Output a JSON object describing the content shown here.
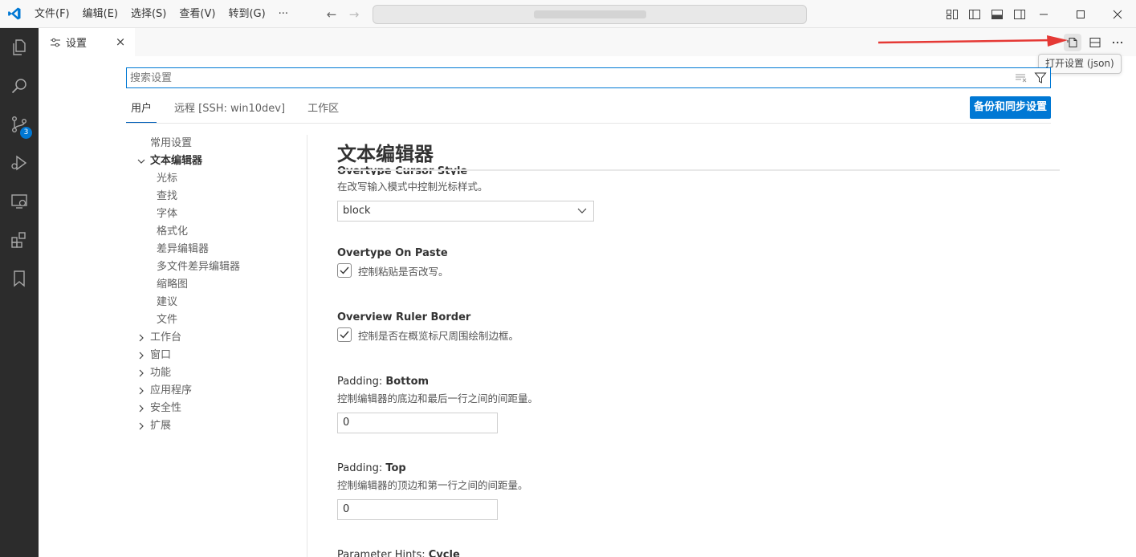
{
  "titlebar": {
    "menus": [
      "文件(F)",
      "编辑(E)",
      "选择(S)",
      "查看(V)",
      "转到(G)",
      "···"
    ]
  },
  "activity": {
    "scm_badge": "3"
  },
  "tab": {
    "label": "设置",
    "close": "×"
  },
  "tooltip": "打开设置 (json)",
  "search": {
    "placeholder": "搜索设置"
  },
  "scopes": {
    "user": "用户",
    "remote": "远程 [SSH: win10dev]",
    "workspace": "工作区"
  },
  "sync_button": "备份和同步设置",
  "toc": {
    "common": "常用设置",
    "text_editor": "文本编辑器",
    "children": [
      "光标",
      "查找",
      "字体",
      "格式化",
      "差异编辑器",
      "多文件差异编辑器",
      "缩略图",
      "建议",
      "文件"
    ],
    "collapsed": [
      "工作台",
      "窗口",
      "功能",
      "应用程序",
      "安全性",
      "扩展"
    ]
  },
  "content": {
    "section_title": "文本编辑器",
    "overtype_cursor_style": {
      "title": "Overtype Cursor Style",
      "desc": "在改写输入模式中控制光标样式。",
      "value": "block"
    },
    "overtype_on_paste": {
      "title": "Overtype On Paste",
      "desc": "控制粘贴是否改写。"
    },
    "overview_ruler_border": {
      "title": "Overview Ruler Border",
      "desc": "控制是否在概览标尺周围绘制边框。"
    },
    "padding_bottom": {
      "category": "Padding: ",
      "name": "Bottom",
      "desc": "控制编辑器的底边和最后一行之间的间距量。",
      "value": "0"
    },
    "padding_top": {
      "category": "Padding: ",
      "name": "Top",
      "desc": "控制编辑器的顶边和第一行之间的间距量。",
      "value": "0"
    },
    "parameter_hints_cycle": {
      "category": "Parameter Hints: ",
      "name": "Cycle"
    }
  },
  "colors": {
    "accent": "#0078d4",
    "activity_bar": "#2c2c2c",
    "arrow": "#e53935"
  }
}
